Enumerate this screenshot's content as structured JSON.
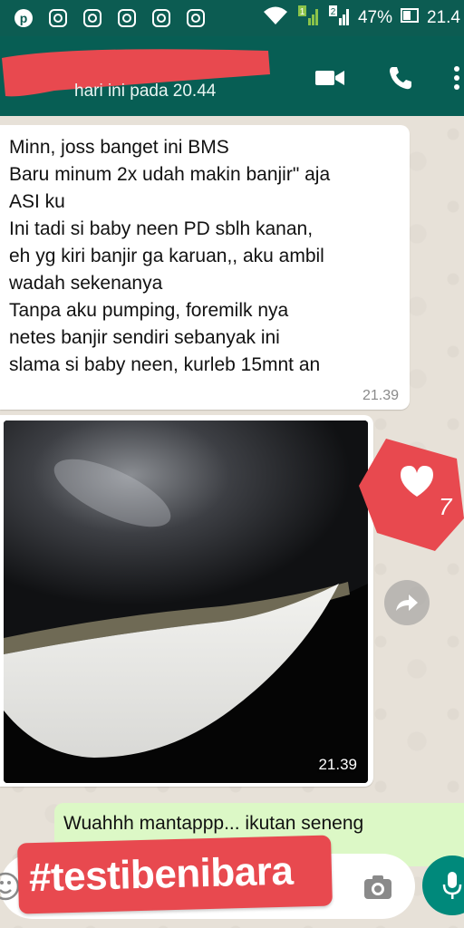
{
  "status_bar": {
    "battery_percent": "47%",
    "clock": "21.4",
    "left_icons": [
      "pinterest-icon",
      "instagram-icon",
      "instagram-icon",
      "instagram-icon",
      "instagram-icon",
      "instagram-icon"
    ],
    "sim_labels": [
      "1",
      "2"
    ]
  },
  "header": {
    "subtitle": "hari ini pada 20.44",
    "actions": [
      "video-call-icon",
      "phone-icon",
      "more-icon"
    ]
  },
  "messages": [
    {
      "type": "text",
      "direction": "incoming",
      "text": "Minn, joss banget ini BMS\nBaru minum 2x udah makin banjir\" aja\nASI ku\nIni tadi si baby neen PD sblh kanan,\neh yg kiri banjir ga karuan,, aku ambil\nwadah sekenanya\nTanpa aku pumping, foremilk nya\nnetes banjir sendiri sebanyak ini\nslama si baby neen, kurleb 15mnt an",
      "time": "21.39"
    },
    {
      "type": "image",
      "direction": "incoming",
      "time": "21.39"
    },
    {
      "type": "text",
      "direction": "outgoing",
      "text": "Wuahhh mantappp... ikutan seneng"
    }
  ],
  "like_badge": {
    "count": "7",
    "color": "#e8494f"
  },
  "overlay_tag": {
    "text": "#testibenibara",
    "color": "#e8494f"
  },
  "colors": {
    "header": "#075e54",
    "status": "#0c5c52",
    "mic": "#00897b",
    "outgoing": "#dcf8c6"
  }
}
